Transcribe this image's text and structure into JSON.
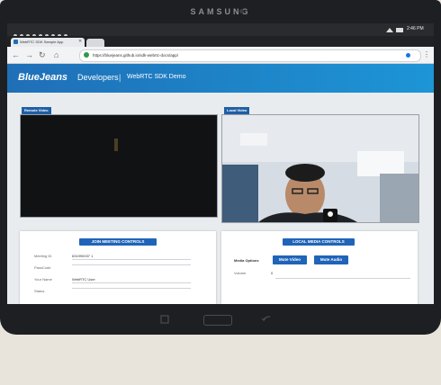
{
  "device": {
    "brand": "SAMSUNG"
  },
  "status_bar": {
    "time": "2:46 PM"
  },
  "browser": {
    "tab_title": "WebRTC SDK Sample App",
    "url": "https://bluejeans.github.io/sdk-webrtc-docs/app/"
  },
  "header": {
    "logo": "BlueJeans",
    "developers": "Developers",
    "separator": "|",
    "subtitle": "WebRTC SDK Demo"
  },
  "remote_video": {
    "label": "Remote Video"
  },
  "local_video": {
    "label": "Local Video"
  },
  "join_meeting": {
    "button": "JOIN MEETING CONTROLS",
    "fields": [
      {
        "label": "Meeting ID",
        "value": "631990037 1"
      },
      {
        "label": "PassCode",
        "value": ""
      },
      {
        "label": "Your Name",
        "value": "WebRTC User"
      },
      {
        "label": "Status",
        "value": ""
      }
    ]
  },
  "local_media": {
    "button": "LOCAL MEDIA CONTROLS",
    "media_options_label": "Media Options",
    "mute_video": "Mute Video",
    "mute_audio": "Mute Audio",
    "volume_label": "Volume",
    "volume_value": "0"
  },
  "colors": {
    "header_start": "#1f6fb7",
    "header_end": "#1d95d6",
    "button": "#1f64b8"
  }
}
